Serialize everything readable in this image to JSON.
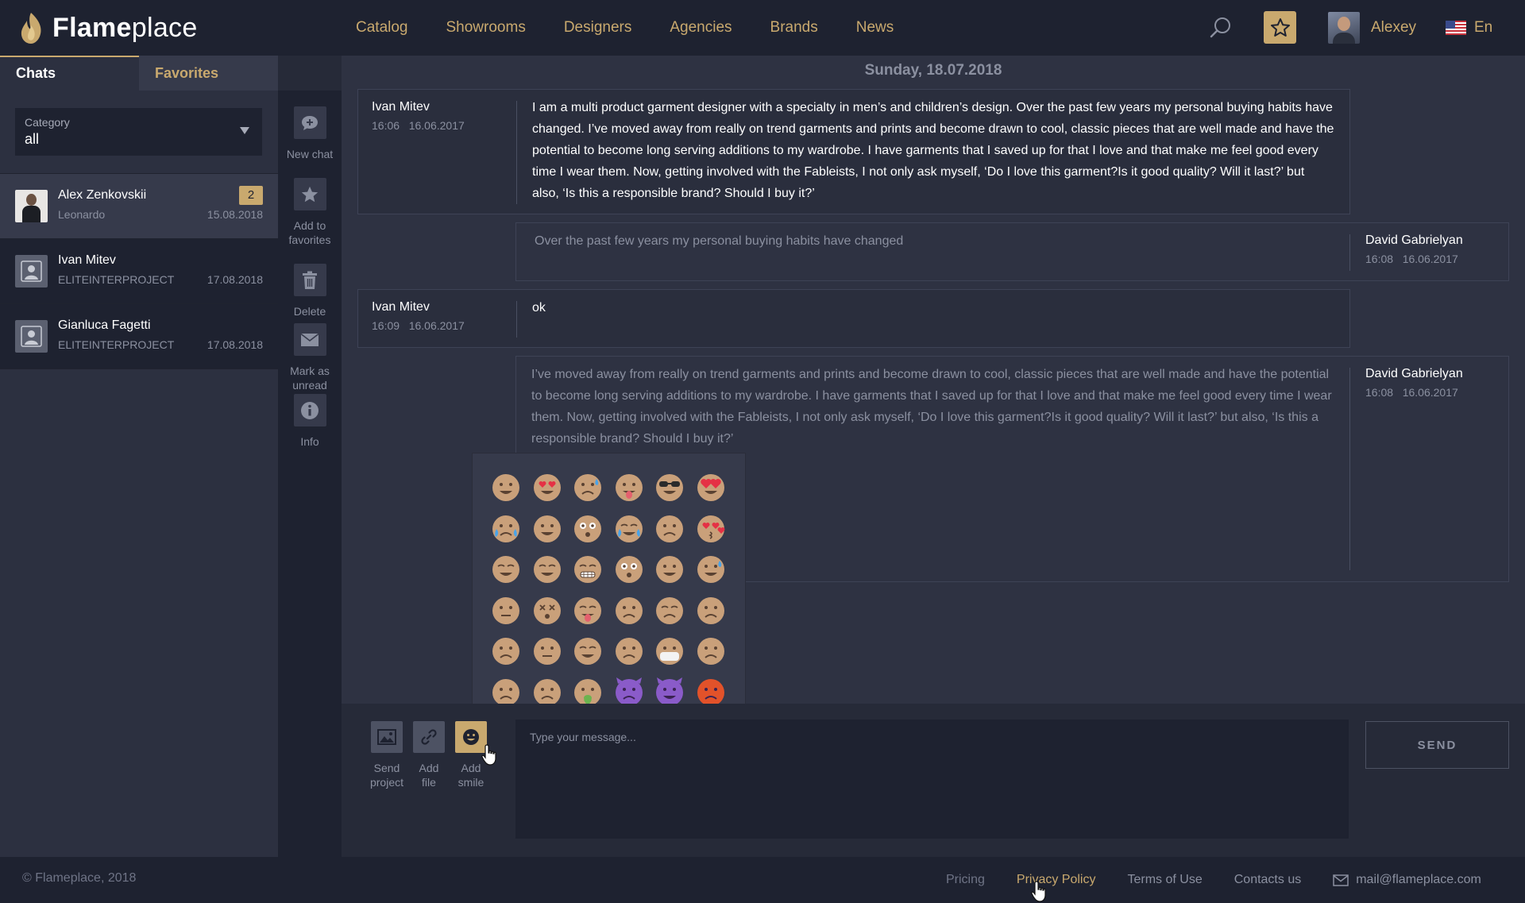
{
  "header": {
    "brand_bold": "Flame",
    "brand_light": "place",
    "nav": [
      "Catalog",
      "Showrooms",
      "Designers",
      "Agencies",
      "Brands",
      "News"
    ],
    "user_name": "Alexey",
    "language": "En",
    "accent_color": "#c9a96e"
  },
  "sidebar": {
    "tabs": [
      "Chats",
      "Favorites"
    ],
    "category_label": "Category",
    "category_value": "all",
    "chats": [
      {
        "name": "Alex Zenkovskii",
        "subtitle": "Leonardo",
        "date": "15.08.2018",
        "badge": "2"
      },
      {
        "name": "Ivan Mitev",
        "subtitle": "ELITEINTERPROJECT",
        "date": "17.08.2018"
      },
      {
        "name": "Gianluca Fagetti",
        "subtitle": "ELITEINTERPROJECT",
        "date": "17.08.2018"
      }
    ]
  },
  "actions": {
    "new_chat": "New chat",
    "add_fav_1": "Add to",
    "add_fav_2": "favorites",
    "delete": "Delete",
    "mark_1": "Mark as",
    "mark_2": "unread",
    "info": "Info"
  },
  "chat": {
    "date_heading": "Sunday, 18.07.2018",
    "messages": [
      {
        "author": "Ivan Mitev",
        "time": "16:06",
        "date": "16.06.2017",
        "text": "I am a multi product garment designer with a specialty in men’s and children’s design. Over the past few years my personal buying habits have changed. I’ve moved away from really on trend garments and prints and become drawn to cool, classic pieces that are well made and have the potential to become long serving additions to my wardrobe. I have garments that I saved up for that I love and that make me feel good every time I wear them. Now, getting involved with the Fableists, I not only ask myself, ‘Do I love this garment?Is it good quality? Will it last?’ but also, ‘Is this a responsible brand? Should I buy it?’"
      },
      {
        "author": "David Gabrielyan",
        "time": "16:08",
        "date": "16.06.2017",
        "text": "Over the past few years my personal buying habits have changed"
      },
      {
        "author": "Ivan Mitev",
        "time": "16:09",
        "date": "16.06.2017",
        "text": "ok"
      },
      {
        "author": "David Gabrielyan",
        "time": "16:08",
        "date": "16.06.2017",
        "text": "I’ve moved away from really on trend garments and prints and become drawn to cool, classic pieces that are well made and have the potential to become long serving additions to my wardrobe. I have garments that I saved up for that I love and that make me feel good every time I wear them. Now, getting involved with the Fableists, I not only ask myself, ‘Do I love this garment?Is it good quality? Will it last?’ but also, ‘Is this a responsible brand? Should I buy it?’"
      }
    ]
  },
  "composer": {
    "send_project_1": "Send",
    "send_project_2": "project",
    "add_file_1": "Add",
    "add_file_2": "file",
    "add_smile_1": "Add",
    "add_smile_2": "smile",
    "placeholder": "Type your message...",
    "send": "SEND"
  },
  "emoji_picker": {
    "emojis": [
      "grinning",
      "heart-eyes",
      "sad-tear",
      "tongue-wink",
      "sunglasses",
      "red-heart-glasses",
      "crying",
      "wink",
      "astonished",
      "joy",
      "unamused",
      "kissing-heart",
      "relieved",
      "smiling-eyes",
      "grimacing",
      "flushed",
      "blushing",
      "sweat-smile",
      "neutral-face",
      "dizzy-face",
      "tongue-closed-eyes",
      "frowning",
      "confounded",
      "pensive",
      "disappointed",
      "expressionless",
      "sleeping",
      "angry-squint",
      "mask",
      "worried",
      "sad",
      "frown",
      "vomiting",
      "purple-devil-angry",
      "purple-devil-smile",
      "angry-red"
    ]
  },
  "footer": {
    "copyright": "© Flameplace, 2018",
    "links": [
      "Pricing",
      "Privacy Policy",
      "Terms of Use",
      "Contacts us"
    ],
    "email": "mail@flameplace.com"
  }
}
